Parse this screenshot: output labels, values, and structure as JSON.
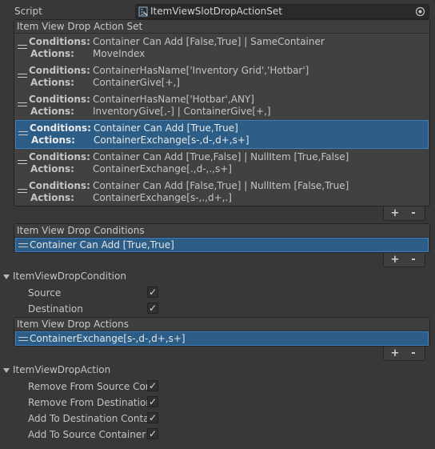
{
  "script": {
    "label": "Script",
    "value": "ItemViewSlotDropActionSet"
  },
  "action_set": {
    "header": "Item View Drop Action Set",
    "conditions_label": "Conditions:",
    "actions_label": "Actions:",
    "rows": [
      {
        "conditions": "Container Can Add [False,True] | SameContainer",
        "actions": "MoveIndex"
      },
      {
        "conditions": "ContainerHasName['Inventory Grid','Hotbar']",
        "actions": "ContainerGive[+,]"
      },
      {
        "conditions": "ContainerHasName['Hotbar',ANY]",
        "actions": "InventoryGive[,-] | ContainerGive[+,]"
      },
      {
        "conditions": "Container Can Add [True,True]",
        "actions": "ContainerExchange[s-,d-,d+,s+]"
      },
      {
        "conditions": "Container Can Add [True,False] | NullItem [True,False]",
        "actions": "ContainerExchange[.,d-,.,s+]"
      },
      {
        "conditions": "Container Can Add [False,True] | NullItem [False,True]",
        "actions": "ContainerExchange[s-,.,d+,.]"
      }
    ],
    "add_label": "+",
    "remove_label": "-"
  },
  "drop_conditions": {
    "header": "Item View Drop Conditions",
    "item": "Container Can Add [True,True]",
    "add_label": "+",
    "remove_label": "-"
  },
  "condition_foldout": {
    "title": "ItemViewDropCondition",
    "fields": [
      {
        "label": "Source",
        "checked": true
      },
      {
        "label": "Destination",
        "checked": true
      }
    ]
  },
  "drop_actions": {
    "header": "Item View Drop Actions",
    "item": "ContainerExchange[s-,d-,d+,s+]",
    "add_label": "+",
    "remove_label": "-"
  },
  "action_foldout": {
    "title": "ItemViewDropAction",
    "fields": [
      {
        "label": "Remove From Source Container",
        "checked": true
      },
      {
        "label": "Remove From Destination Container",
        "checked": true
      },
      {
        "label": "Add To Destination Container",
        "checked": true
      },
      {
        "label": "Add To Source Container",
        "checked": true
      }
    ]
  },
  "checkmark": "✓",
  "selected_row_color": "#2c5d87"
}
